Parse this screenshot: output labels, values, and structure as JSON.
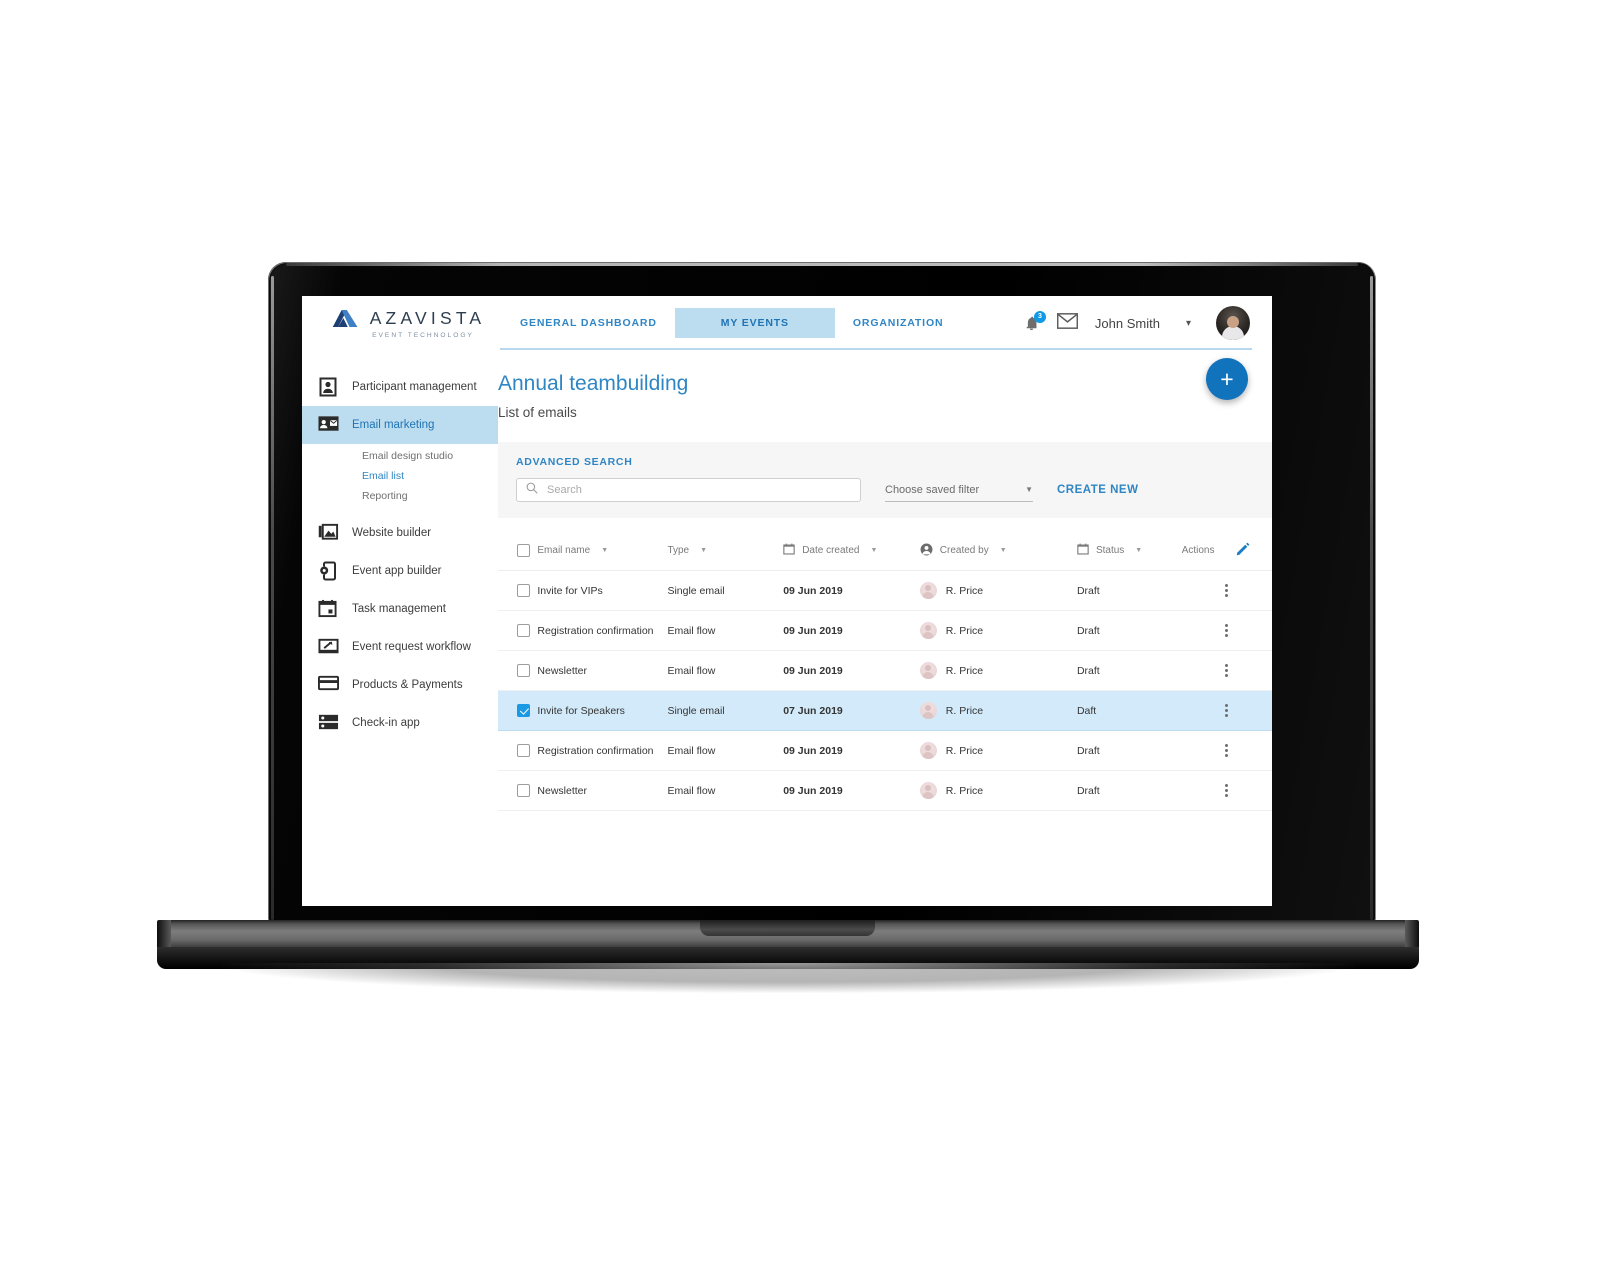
{
  "brand": {
    "name": "AZAVISTA",
    "tagline": "EVENT TECHNOLOGY",
    "accent": "#2f86c5",
    "logo_dark": "#1d3f73",
    "logo_light": "#3f7fc4"
  },
  "topnav": {
    "tabs": [
      {
        "label": "GENERAL DASHBOARD",
        "active": false
      },
      {
        "label": "MY EVENTS",
        "active": true
      },
      {
        "label": "ORGANIZATION",
        "active": false
      }
    ],
    "notifications_badge": "3",
    "user_name": "John Smith",
    "bell_icon": "bell-icon",
    "mail_icon": "envelope-icon",
    "caret_icon": "chevron-down-icon"
  },
  "sidebar": {
    "items": [
      {
        "label": "Participant management",
        "icon": "contact-card-icon",
        "active": false
      },
      {
        "label": "Email marketing",
        "icon": "email-contact-icon",
        "active": true
      },
      {
        "label": "Website builder",
        "icon": "images-icon",
        "active": false
      },
      {
        "label": "Event app builder",
        "icon": "mobile-gear-icon",
        "active": false
      },
      {
        "label": "Task management",
        "icon": "calendar-icon",
        "active": false
      },
      {
        "label": "Event request workflow",
        "icon": "presentation-arrow-icon",
        "active": false
      },
      {
        "label": "Products & Payments",
        "icon": "credit-card-icon",
        "active": false
      },
      {
        "label": "Check-in app",
        "icon": "checkin-list-icon",
        "active": false
      }
    ],
    "subitems": [
      {
        "label": "Email design studio",
        "active": false
      },
      {
        "label": "Email list",
        "active": true
      },
      {
        "label": "Reporting",
        "active": false
      }
    ]
  },
  "page": {
    "title": "Annual teambuilding",
    "subtitle": "List of emails",
    "fab_label": "+",
    "fab_icon": "plus-icon"
  },
  "search": {
    "section_label": "ADVANCED SEARCH",
    "placeholder": "Search",
    "value": "",
    "saved_filter_label": "Choose saved filter",
    "create_new_label": "CREATE NEW",
    "search_icon": "search-icon"
  },
  "table": {
    "columns": [
      {
        "key": "checkbox",
        "label": "",
        "icon": "",
        "sortable": false
      },
      {
        "key": "name",
        "label": "Email name",
        "icon": "",
        "sortable": true
      },
      {
        "key": "type",
        "label": "Type",
        "icon": "",
        "sortable": true
      },
      {
        "key": "date",
        "label": "Date created",
        "icon": "calendar-icon",
        "sortable": true
      },
      {
        "key": "by",
        "label": "Created by",
        "icon": "person-icon",
        "sortable": true
      },
      {
        "key": "status",
        "label": "Status",
        "icon": "calendar-icon",
        "sortable": true
      },
      {
        "key": "actions",
        "label": "Actions",
        "icon": "pencil-icon",
        "sortable": false
      }
    ],
    "rows": [
      {
        "checked": false,
        "name": "Invite for VIPs",
        "type": "Single email",
        "date": "09 Jun 2019",
        "by": "R. Price",
        "status": "Draft",
        "selected": false
      },
      {
        "checked": false,
        "name": "Registration confirmation",
        "type": "Email flow",
        "date": "09 Jun 2019",
        "by": "R. Price",
        "status": "Draft",
        "selected": false
      },
      {
        "checked": false,
        "name": "Newsletter",
        "type": "Email flow",
        "date": "09 Jun 2019",
        "by": "R. Price",
        "status": "Draft",
        "selected": false
      },
      {
        "checked": true,
        "name": "Invite for Speakers",
        "type": "Single email",
        "date": "07 Jun 2019",
        "by": "R. Price",
        "status": "Daft",
        "selected": true
      },
      {
        "checked": false,
        "name": "Registration confirmation",
        "type": "Email flow",
        "date": "09 Jun 2019",
        "by": "R. Price",
        "status": "Draft",
        "selected": false
      },
      {
        "checked": false,
        "name": "Newsletter",
        "type": "Email flow",
        "date": "09 Jun 2019",
        "by": "R. Price",
        "status": "Draft",
        "selected": false
      }
    ]
  }
}
